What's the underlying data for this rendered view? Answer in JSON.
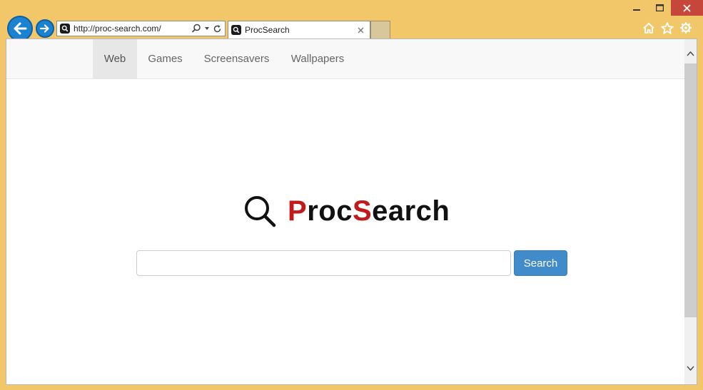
{
  "browser": {
    "address_url": "http://proc-search.com/",
    "tab_title": "ProcSearch"
  },
  "nav": {
    "items": [
      {
        "label": "Web",
        "active": true
      },
      {
        "label": "Games",
        "active": false
      },
      {
        "label": "Screensavers",
        "active": false
      },
      {
        "label": "Wallpapers",
        "active": false
      }
    ]
  },
  "logo": {
    "part1_red": "P",
    "part2": "roc",
    "part3_red": "S",
    "part4": "earch"
  },
  "search": {
    "value": "",
    "button_label": "Search"
  },
  "colors": {
    "frame": "#F1C769",
    "accent_blue": "#428BCA",
    "logo_red": "#C21A1A"
  }
}
